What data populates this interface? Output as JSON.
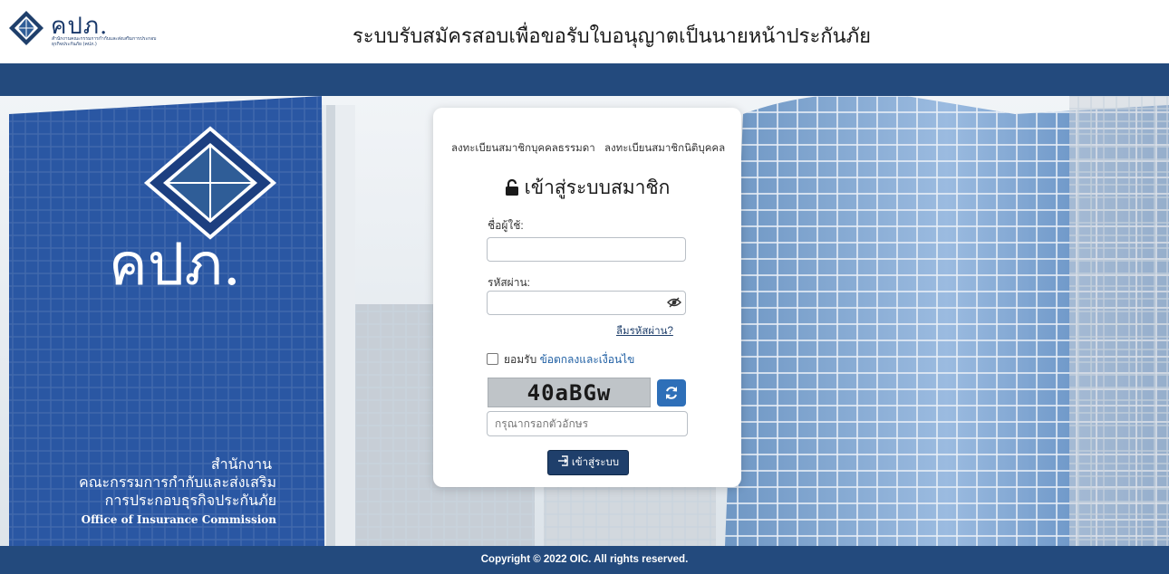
{
  "header": {
    "logo_text": "คปภ.",
    "logo_subtext": "สำนักงานคณะกรรมการกำกับและส่งเสริมการประกอบธุรกิจประกันภัย (คปภ.)",
    "title": "ระบบรับสมัครสอบเพื่อขอรับใบอนุญาตเป็นนายหน้าประกันภัย"
  },
  "hero": {
    "sign_logo": "คปภ.",
    "sign_line1": "สำนักงาน",
    "sign_line2": "คณะกรรมการกำกับและส่งเสริม",
    "sign_line3": "การประกอบธุรกิจประกันภัย",
    "sign_line4": "Office of Insurance Commission"
  },
  "login": {
    "register_individual": "ลงทะเบียนสมาชิกบุคคลธรรมดา",
    "register_juristic": "ลงทะเบียนสมาชิกนิติบุคคล",
    "title": "เข้าสู่ระบบสมาชิก",
    "username_label": "ชื่อผู้ใช้:",
    "username_value": "",
    "password_label": "รหัสผ่าน:",
    "password_value": "",
    "forgot_password": "ลืมรหัสผ่าน?",
    "accept_label": "ยอมรับ",
    "terms_link": "ข้อตกลงและเงื่อนไข",
    "accept_checked": false,
    "captcha_text": "40aBGw",
    "captcha_placeholder": "กรุณากรอกตัวอักษร",
    "submit_label": "เข้าสู่ระบบ",
    "icons": {
      "lock": "unlock-icon",
      "eye": "eye-slash-icon",
      "refresh": "refresh-icon",
      "submit": "sign-in-icon"
    }
  },
  "footer": {
    "copyright": "Copyright © 2022 OIC. All rights reserved."
  },
  "colors": {
    "primary": "#234a7d",
    "button": "#1f3f6b",
    "refresh": "#2e6fb8",
    "link": "#1f5fa3"
  }
}
